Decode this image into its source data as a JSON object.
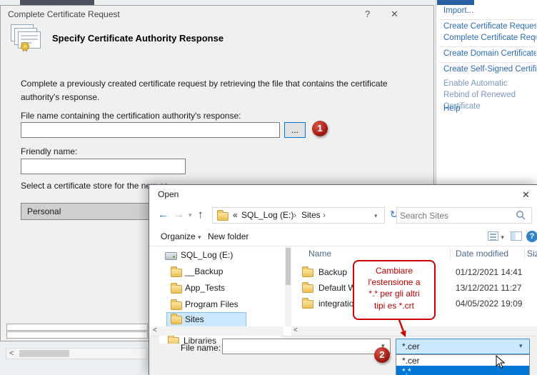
{
  "icons": {
    "help": "?",
    "close": "✕",
    "back": "←",
    "forward": "→",
    "up": "↑",
    "refresh": "↻",
    "chevron_down": "▾",
    "breadcrumb_separator": "›",
    "scroll_left": "<"
  },
  "main_dialog": {
    "title": "Complete Certificate Request",
    "heading": "Specify Certificate Authority Response",
    "description": "Complete a previously created certificate request by retrieving the file that contains the certificate authority's response.",
    "file_field": {
      "label": "File name containing the certification authority's response:",
      "value": "",
      "browse_label": "..."
    },
    "friendly_field": {
      "label": "Friendly name:",
      "value": ""
    },
    "store_field": {
      "label": "Select a certificate store for the new ce",
      "value": "Personal"
    }
  },
  "actions_panel": {
    "items": [
      "Import...",
      "Create Certificate Request...",
      "Complete Certificate Request...",
      "Create Domain Certificate...",
      "Create Self-Signed Certificate...",
      "Enable Automatic Rebind of Renewed Certificate",
      "Help"
    ]
  },
  "open_dialog": {
    "title": "Open",
    "breadcrumb": {
      "prefix": "«",
      "crumbs": [
        "SQL_Log (E:)",
        "Sites"
      ]
    },
    "search": {
      "placeholder": "Search Sites",
      "value": ""
    },
    "toolbar": {
      "organize": "Organize",
      "new_folder": "New folder"
    },
    "tree": [
      "SQL_Log (E:)",
      "__Backup",
      "App_Tests",
      "Program Files",
      "Sites",
      "Libraries"
    ],
    "selected_tree_item": "Sites",
    "list": {
      "columns": [
        "Name",
        "Date modified",
        "Size"
      ],
      "rows": [
        {
          "name": "Backup",
          "date_modified": "01/12/2021 14:41"
        },
        {
          "name": "Default Web Site",
          "date_modified": "13/12/2021 11:27"
        },
        {
          "name": "integrations",
          "date_modified": "04/05/2022 19:09"
        }
      ]
    },
    "footer": {
      "file_name_label": "File name:",
      "file_name_value": "",
      "file_type_value": "*.cer",
      "file_type_options": [
        "*.cer",
        "*.*"
      ]
    }
  },
  "annotations": {
    "badge_1": "1",
    "badge_2": "2",
    "callout": "Cambiare\nl'estensione a\n*.* per gli altri\ntipi es *.crt"
  }
}
